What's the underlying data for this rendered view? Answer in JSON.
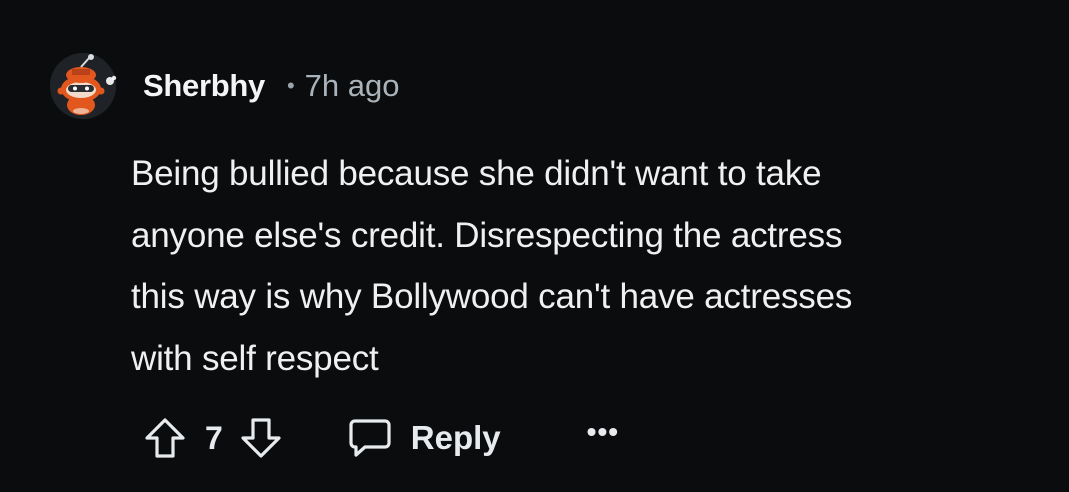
{
  "comment": {
    "author": "Sherbhy",
    "separator": "•",
    "timestamp": "7h ago",
    "body_lines": [
      "Being bullied because she didn't want to take",
      "anyone else's credit. Disrespecting the actress",
      "this way is why Bollywood can't have actresses",
      "with self respect"
    ]
  },
  "actions": {
    "upvote_icon": "arrow-up-outline-icon",
    "score": "7",
    "downvote_icon": "arrow-down-outline-icon",
    "reply_icon": "speech-bubble-icon",
    "reply_label": "Reply",
    "more_label": "•••"
  },
  "colors": {
    "background": "#0b0c0e",
    "text": "#eef0f2",
    "muted": "#aab3ba",
    "avatar_accent": "#e2571e"
  }
}
